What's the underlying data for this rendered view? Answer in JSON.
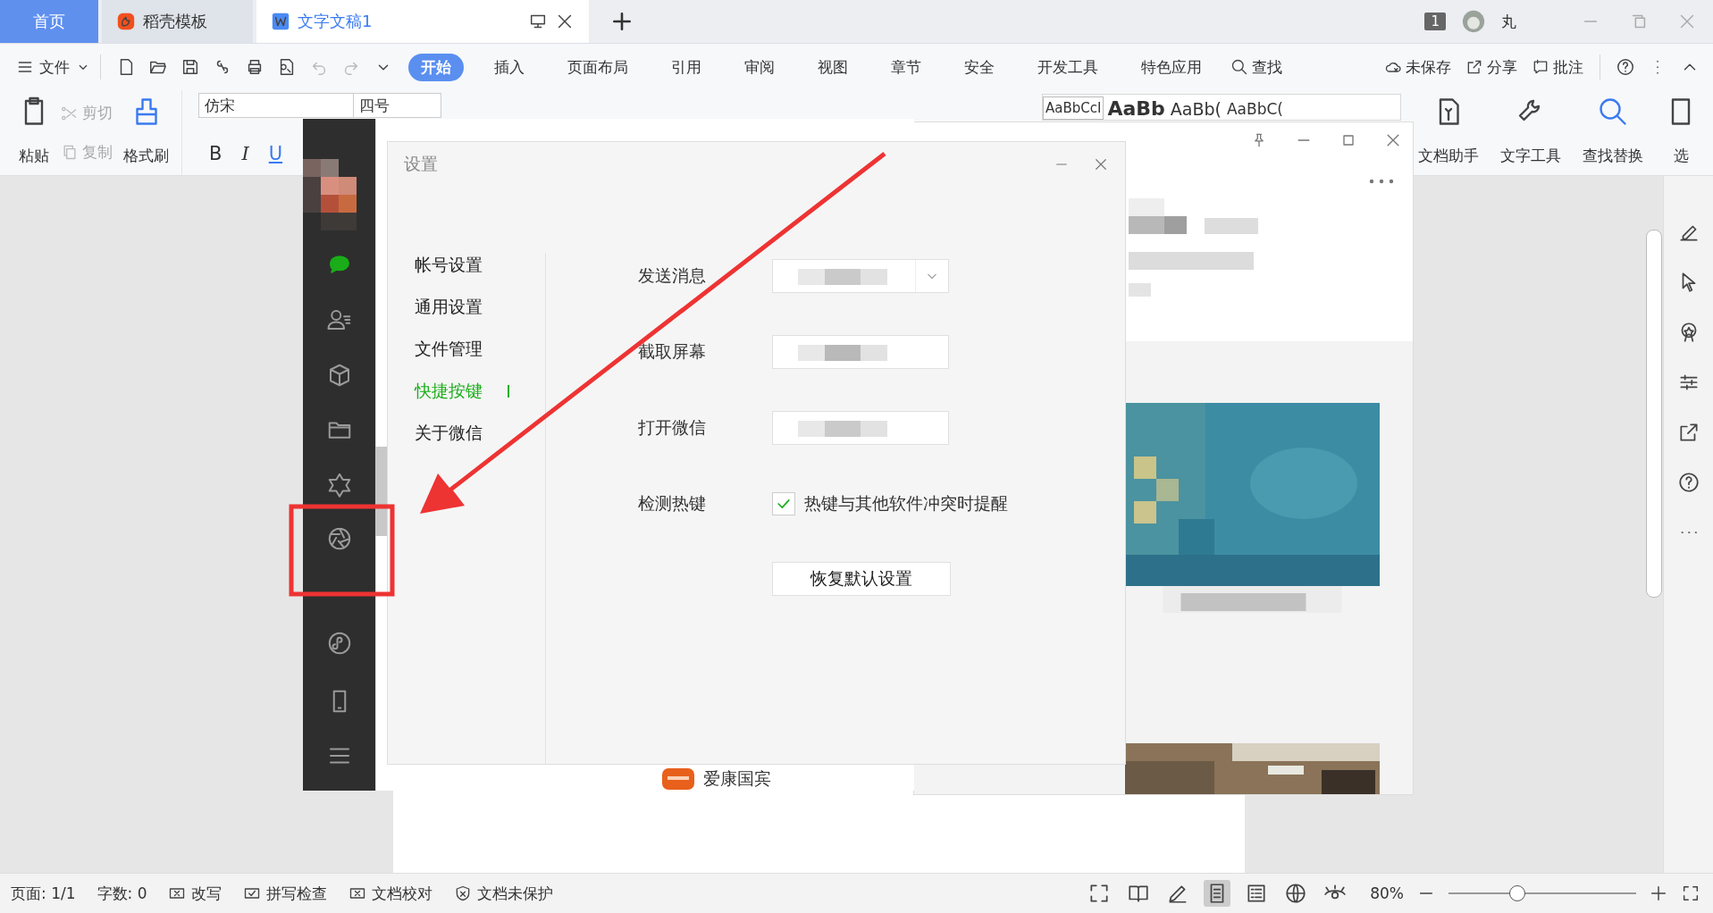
{
  "tabs": [
    {
      "label": "首页",
      "selected": false,
      "kind": "home"
    },
    {
      "label": "稻壳模板",
      "selected": false,
      "kind": "docer"
    },
    {
      "label": "文字文稿1",
      "selected": true,
      "kind": "doc"
    }
  ],
  "title_bar": {
    "badge": "1",
    "user": "丸"
  },
  "menu": {
    "file": "文件",
    "items": [
      {
        "label": "开始",
        "selected": true
      },
      {
        "label": "插入",
        "selected": false
      },
      {
        "label": "页面布局",
        "selected": false
      },
      {
        "label": "引用",
        "selected": false
      },
      {
        "label": "审阅",
        "selected": false
      },
      {
        "label": "视图",
        "selected": false
      },
      {
        "label": "章节",
        "selected": false
      },
      {
        "label": "安全",
        "selected": false
      },
      {
        "label": "开发工具",
        "selected": false
      },
      {
        "label": "特色应用",
        "selected": false
      }
    ],
    "search": "查找",
    "actions": [
      {
        "label": "未保存",
        "kind": "cloud"
      },
      {
        "label": "分享",
        "kind": "share"
      },
      {
        "label": "批注",
        "kind": "comment"
      }
    ]
  },
  "ribbon": {
    "paste": "粘贴",
    "cut": "剪切",
    "copy": "复制",
    "format_painter": "格式刷",
    "font": "仿宋",
    "size": "四号",
    "format": [
      "B",
      "I",
      "U"
    ],
    "styles": [
      "AaBbCcI",
      "AaBb",
      "AaBb(",
      "AaBbC("
    ],
    "tools": [
      {
        "label": "文档助手",
        "kind": "assistant"
      },
      {
        "label": "文字工具",
        "kind": "wrench"
      },
      {
        "label": "查找替换",
        "kind": "search"
      },
      {
        "label": "选",
        "kind": "select"
      }
    ]
  },
  "wechat_sidebar": {
    "items": [
      {
        "kind": "chat",
        "selected": true
      },
      {
        "kind": "contacts",
        "selected": false
      },
      {
        "kind": "box",
        "selected": false
      },
      {
        "kind": "folder",
        "selected": false
      },
      {
        "kind": "moments",
        "selected": false
      },
      {
        "kind": "aperture",
        "selected": false
      },
      {
        "kind": "mini",
        "selected": false
      },
      {
        "kind": "phone",
        "selected": false
      },
      {
        "kind": "menu",
        "selected": false
      }
    ]
  },
  "chat_list": {
    "last_item": "爱康国宾"
  },
  "settings_dialog": {
    "title": "设置",
    "nav": [
      {
        "label": "帐号设置",
        "selected": false
      },
      {
        "label": "通用设置",
        "selected": false
      },
      {
        "label": "文件管理",
        "selected": false
      },
      {
        "label": "快捷按键",
        "selected": true
      },
      {
        "label": "关于微信",
        "selected": false
      }
    ],
    "shortcuts": [
      {
        "label": "发送消息",
        "kind": "dropdown"
      },
      {
        "label": "截取屏幕",
        "kind": "field"
      },
      {
        "label": "打开微信",
        "kind": "field"
      }
    ],
    "detect": {
      "label": "检测热键",
      "option": "热键与其他软件冲突时提醒",
      "checked": true
    },
    "reset_button": "恢复默认设置"
  },
  "status_bar": {
    "page": "页面: 1/1",
    "words": "字数: 0",
    "items": [
      {
        "label": "改写",
        "kind": "boxx"
      },
      {
        "label": "拼写检查",
        "kind": "boxcheck"
      },
      {
        "label": "文档校对",
        "kind": "boxx"
      },
      {
        "label": "文档未保护",
        "kind": "shield"
      }
    ],
    "views": [
      {
        "kind": "fullscreen",
        "selected": false
      },
      {
        "kind": "book",
        "selected": false
      },
      {
        "kind": "pencil",
        "selected": false
      },
      {
        "kind": "page",
        "selected": true
      },
      {
        "kind": "outline",
        "selected": false
      },
      {
        "kind": "globe",
        "selected": false
      },
      {
        "kind": "eye",
        "selected": false
      }
    ],
    "zoom": "80%",
    "zoom_level": {
      "level": 0.36
    }
  }
}
